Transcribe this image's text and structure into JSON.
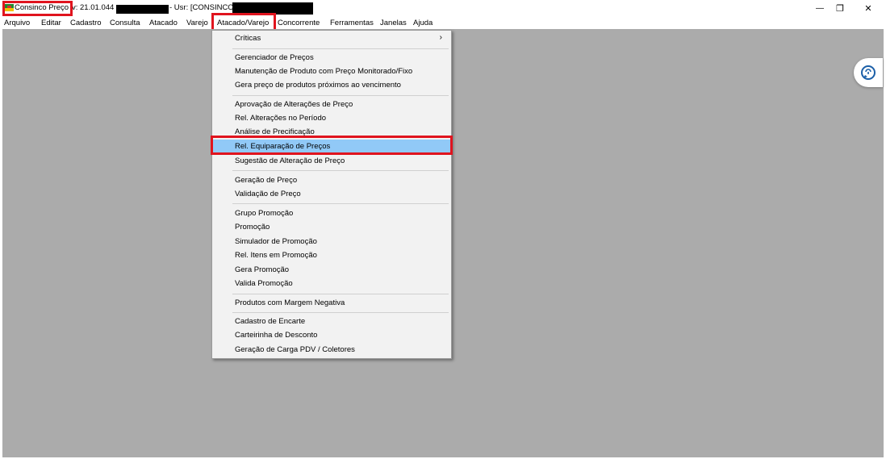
{
  "window": {
    "app_name": "Consinco Preço",
    "title_suffix": "v: 21.01.044",
    "user_label": "- Usr: [CONSINCO] -",
    "minimize_glyph": "—",
    "maximize_glyph": "❐",
    "close_glyph": "✕"
  },
  "menubar": {
    "items": [
      "Arquivo",
      "Editar",
      "Cadastro",
      "Consulta",
      "Atacado",
      "Varejo",
      "Atacado/Varejo",
      "Concorrente",
      "Ferramentas",
      "Janelas",
      "Ajuda"
    ],
    "active": "Atacado/Varejo"
  },
  "dropdown": {
    "items": [
      "Críticas",
      "Gerenciador de Preços",
      "Manutenção de Produto com Preço Monitorado/Fixo",
      "Gera preço de produtos próximos ao vencimento",
      "Aprovação de Alterações de Preço",
      "Rel. Alterações no Período",
      "Análise de Precificação",
      "Rel. Equiparação de Preços",
      "Sugestão de Alteração de Preço",
      "Geração de Preço",
      "Validação de Preço",
      "Grupo Promoção",
      "Promoção",
      "Simulador de Promoção",
      "Rel. Itens em Promoção",
      "Gera Promoção",
      "Valida Promoção",
      "Produtos com Margem Negativa",
      "Cadastro de Encarte",
      "Carteirinha de Desconto",
      "Geração de Carga PDV / Coletores"
    ],
    "submenu_arrow": "›",
    "selected": "Rel. Equiparação de Preços"
  },
  "icons": {
    "app": "app-logo-icon",
    "chat": "chat-assistant-icon"
  },
  "colors": {
    "highlight_border": "#e0141e",
    "selection": "#91c9f7",
    "workspace": "#ababab"
  }
}
